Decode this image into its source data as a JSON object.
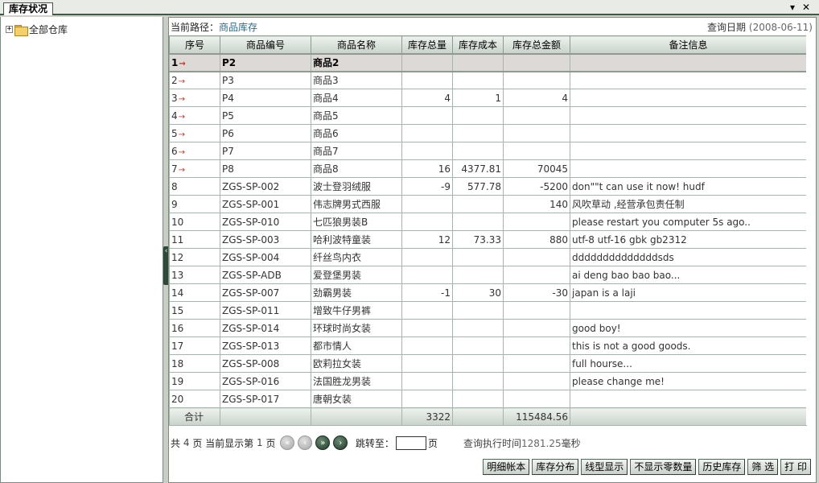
{
  "tab": {
    "title": "库存状况"
  },
  "controls": {
    "dropdown": "▾",
    "close": "✕"
  },
  "tree": {
    "root_label": "全部仓库",
    "expand_glyph": "+"
  },
  "path": {
    "prefix": "当前路径：",
    "link": "商品库存"
  },
  "query": {
    "date_label": "查询日期",
    "date_value": "(2008-06-11)"
  },
  "table": {
    "headers": [
      "序号",
      "商品编号",
      "商品名称",
      "库存总量",
      "库存成本",
      "库存总金额",
      "备注信息"
    ],
    "rows": [
      {
        "no": "1",
        "code": "P2",
        "name": "商品2",
        "qty": "",
        "cost": "",
        "amount": "",
        "note": "",
        "arrow": "→"
      },
      {
        "no": "2",
        "code": "P3",
        "name": "商品3",
        "qty": "",
        "cost": "",
        "amount": "",
        "note": "",
        "arrow": "→"
      },
      {
        "no": "3",
        "code": "P4",
        "name": "商品4",
        "qty": "4",
        "cost": "1",
        "amount": "4",
        "note": "",
        "arrow": "→"
      },
      {
        "no": "4",
        "code": "P5",
        "name": "商品5",
        "qty": "",
        "cost": "",
        "amount": "",
        "note": "",
        "arrow": "→"
      },
      {
        "no": "5",
        "code": "P6",
        "name": "商品6",
        "qty": "",
        "cost": "",
        "amount": "",
        "note": "",
        "arrow": "→"
      },
      {
        "no": "6",
        "code": "P7",
        "name": "商品7",
        "qty": "",
        "cost": "",
        "amount": "",
        "note": "",
        "arrow": "→"
      },
      {
        "no": "7",
        "code": "P8",
        "name": "商品8",
        "qty": "16",
        "cost": "4377.81",
        "amount": "70045",
        "note": "",
        "arrow": "→"
      },
      {
        "no": "8",
        "code": "ZGS-SP-002",
        "name": "波士登羽绒服",
        "qty": "-9",
        "cost": "577.78",
        "amount": "-5200",
        "note": "don\"\"t can use it now! hudf",
        "arrow": ""
      },
      {
        "no": "9",
        "code": "ZGS-SP-001",
        "name": "伟志牌男式西服",
        "qty": "",
        "cost": "",
        "amount": "140",
        "note": "风吹草动 ,经营承包责任制",
        "arrow": ""
      },
      {
        "no": "10",
        "code": "ZGS-SP-010",
        "name": "七匹狼男装B",
        "qty": "",
        "cost": "",
        "amount": "",
        "note": "please restart you computer 5s ago..",
        "arrow": ""
      },
      {
        "no": "11",
        "code": "ZGS-SP-003",
        "name": "哈利波特童装",
        "qty": "12",
        "cost": "73.33",
        "amount": "880",
        "note": "utf-8 utf-16 gbk gb2312",
        "arrow": ""
      },
      {
        "no": "12",
        "code": "ZGS-SP-004",
        "name": "纤丝鸟内衣",
        "qty": "",
        "cost": "",
        "amount": "",
        "note": "ddddddddddddddsds",
        "arrow": ""
      },
      {
        "no": "13",
        "code": "ZGS-SP-ADB",
        "name": "爱登堡男装",
        "qty": "",
        "cost": "",
        "amount": "",
        "note": "ai deng bao bao bao...",
        "arrow": ""
      },
      {
        "no": "14",
        "code": "ZGS-SP-007",
        "name": "劲霸男装",
        "qty": "-1",
        "cost": "30",
        "amount": "-30",
        "note": "japan is a laji",
        "arrow": ""
      },
      {
        "no": "15",
        "code": "ZGS-SP-011",
        "name": "增致牛仔男裤",
        "qty": "",
        "cost": "",
        "amount": "",
        "note": "",
        "arrow": ""
      },
      {
        "no": "16",
        "code": "ZGS-SP-014",
        "name": "环球时尚女装",
        "qty": "",
        "cost": "",
        "amount": "",
        "note": "good boy!",
        "arrow": ""
      },
      {
        "no": "17",
        "code": "ZGS-SP-013",
        "name": "都市情人",
        "qty": "",
        "cost": "",
        "amount": "",
        "note": "this is not a good goods.",
        "arrow": ""
      },
      {
        "no": "18",
        "code": "ZGS-SP-008",
        "name": "欧莉拉女装",
        "qty": "",
        "cost": "",
        "amount": "",
        "note": "full hourse...",
        "arrow": ""
      },
      {
        "no": "19",
        "code": "ZGS-SP-016",
        "name": "法国胜龙男装",
        "qty": "",
        "cost": "",
        "amount": "",
        "note": "please change me!",
        "arrow": ""
      },
      {
        "no": "20",
        "code": "ZGS-SP-017",
        "name": "唐朝女装",
        "qty": "",
        "cost": "",
        "amount": "",
        "note": "",
        "arrow": ""
      }
    ],
    "total": {
      "label": "合计",
      "qty": "3322",
      "amount": "115484.56"
    }
  },
  "pager": {
    "total_prefix": "共",
    "total_pages": "4",
    "total_suffix": "页 当前显示第",
    "current_page": "1",
    "current_suffix": "页",
    "first_icon": "«",
    "prev_icon": "‹",
    "next_icon": "»",
    "last_icon": "›",
    "jump_label": "跳转至：",
    "jump_suffix": "页",
    "exec_label": "查询执行时间",
    "exec_value": "1281.25",
    "exec_unit": "毫秒"
  },
  "toolbar": {
    "buttons": [
      "明细帐本",
      "库存分布",
      "线型显示",
      "不显示零数量",
      "历史库存",
      "筛 选",
      "打 印"
    ]
  },
  "colors": {
    "accent": "#2d4a38",
    "link": "#2b6a8c",
    "arrow": "#c0392b"
  }
}
